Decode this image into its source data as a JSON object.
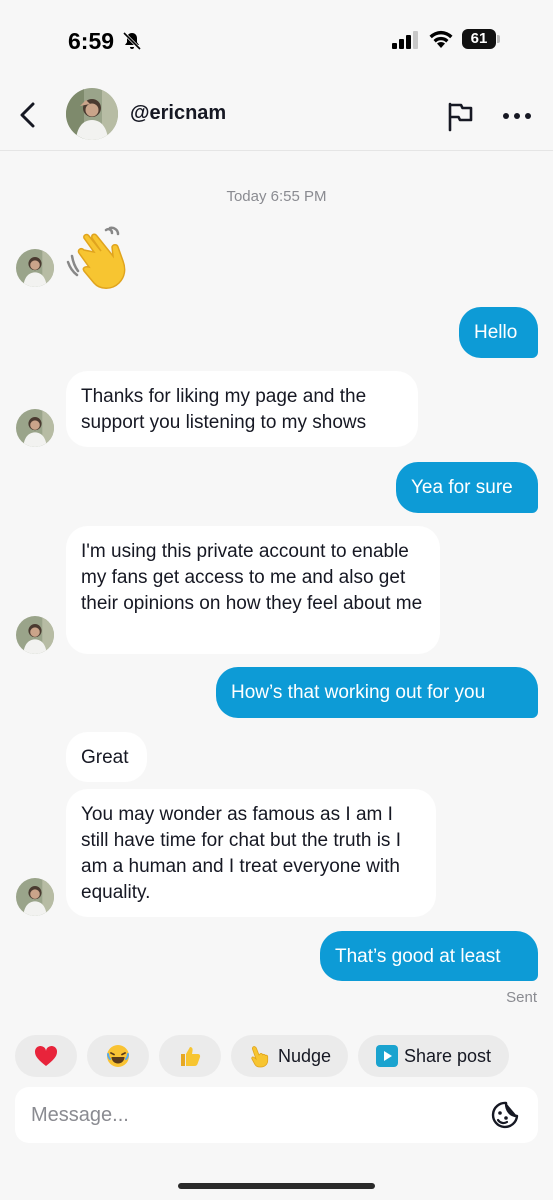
{
  "status_bar": {
    "time": "6:59",
    "battery": "61"
  },
  "header": {
    "username": "@ericnam"
  },
  "conversation": {
    "timestamp": "Today 6:55 PM",
    "messages": [
      {
        "from": "them",
        "type": "emoji",
        "icon": "waving-hand-icon"
      },
      {
        "from": "me",
        "text": "Hello"
      },
      {
        "from": "them",
        "text": "Thanks for liking my page and the support you listening to my shows"
      },
      {
        "from": "me",
        "text": "Yea for sure"
      },
      {
        "from": "them",
        "text": "I'm using this private account to enable my fans get access to me and also get their opinions on how they feel about me"
      },
      {
        "from": "me",
        "text": "How’s that working out for you"
      },
      {
        "from": "them",
        "text": "Great"
      },
      {
        "from": "them",
        "text": "You may wonder as famous as I am I still have time for chat but the truth is I am a human and I treat everyone with equality."
      },
      {
        "from": "me",
        "text": "That’s good at least"
      }
    ],
    "status": "Sent"
  },
  "quick_actions": [
    {
      "icon": "heart-icon"
    },
    {
      "icon": "laughing-face-icon"
    },
    {
      "icon": "thumbs-up-icon"
    },
    {
      "icon": "pointing-hand-icon",
      "label": "Nudge"
    },
    {
      "icon": "share-post-icon",
      "label": "Share post"
    }
  ],
  "composer": {
    "placeholder": "Message..."
  },
  "colors": {
    "outgoing_bubble": "#0d9bd6",
    "incoming_bubble": "#ffffff",
    "background": "#f7f7f7"
  }
}
